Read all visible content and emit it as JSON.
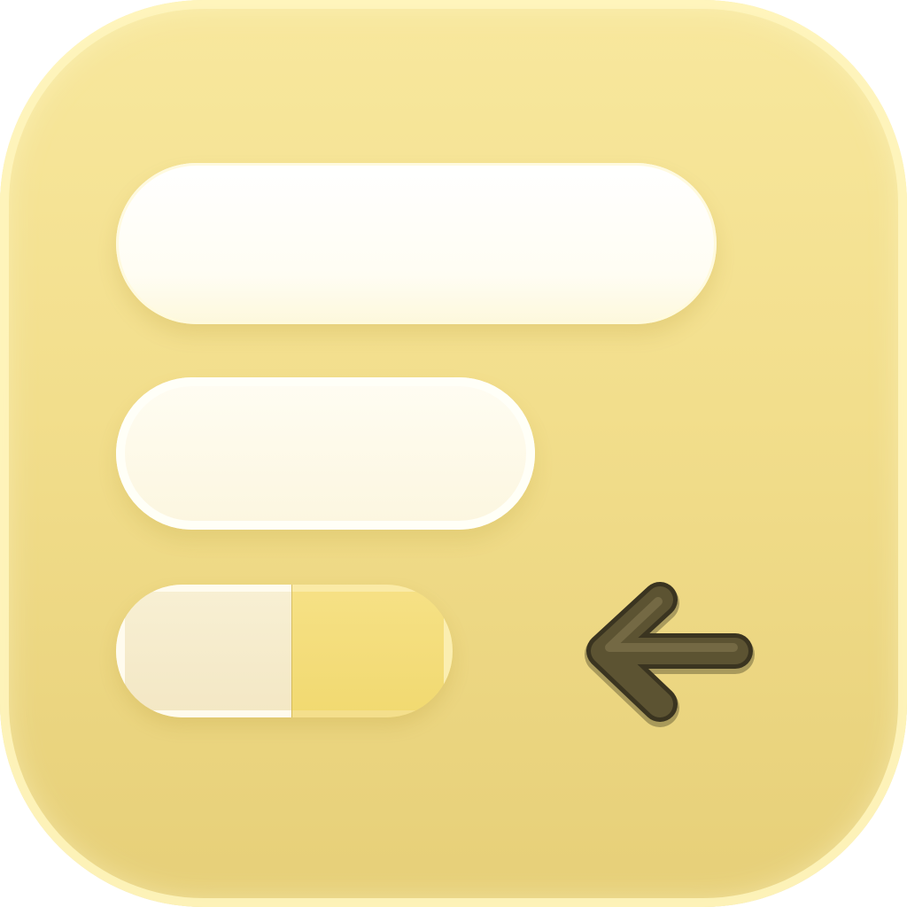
{
  "icon": {
    "name": "indent-decrease-app-icon",
    "colors": {
      "background_top": "#f8e89e",
      "background_bottom": "#e6cf78",
      "bar_white": "#ffffff",
      "bar_cream": "#fcf6df",
      "progress_filled": "#f1d970",
      "progress_empty": "#f3e7c4",
      "arrow": "#5c5332"
    },
    "progress_bar": {
      "filled_fraction": 0.48
    },
    "arrow_icon": "arrow-left-icon"
  }
}
